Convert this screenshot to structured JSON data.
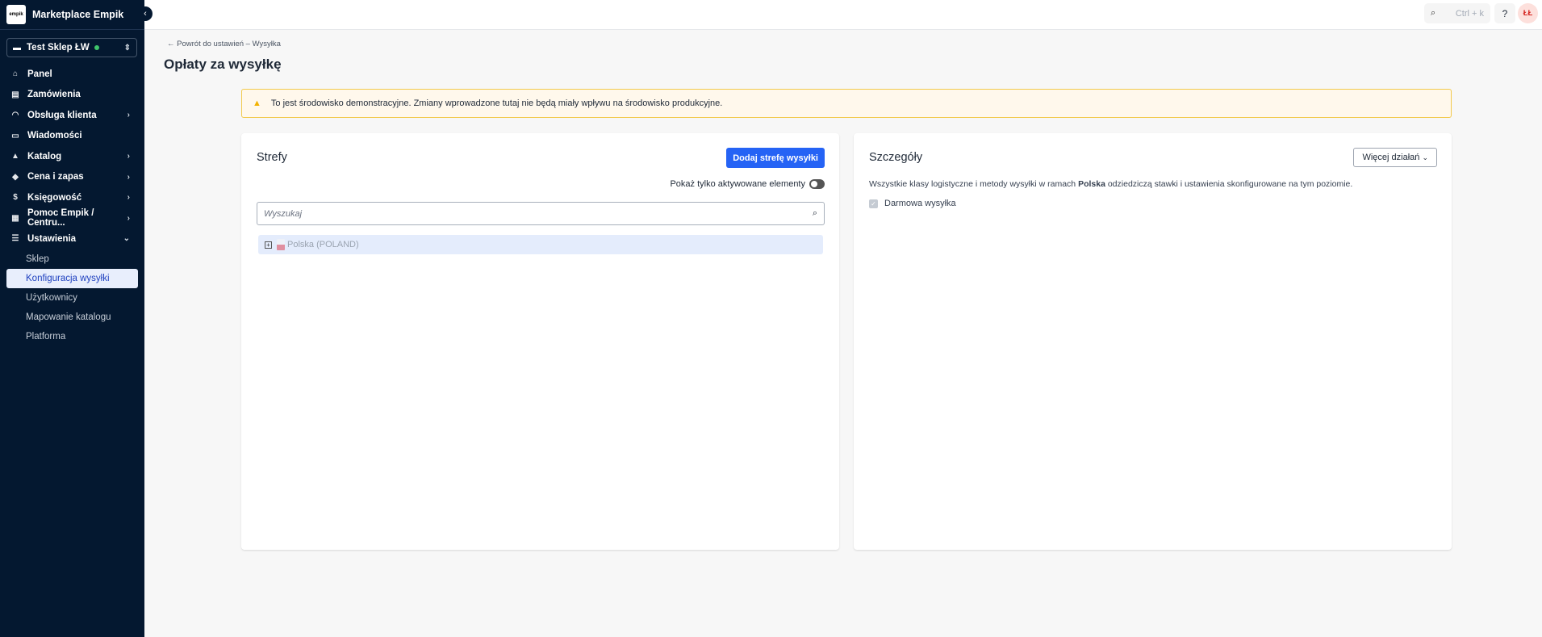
{
  "sidebar": {
    "brand": "Marketplace Empik",
    "logo_text": "empik",
    "store": "Test Sklep ŁW",
    "items": [
      {
        "label": "Panel",
        "icon": "home-icon",
        "glyph": "⌂",
        "chev": ""
      },
      {
        "label": "Zamówienia",
        "icon": "clipboard-icon",
        "glyph": "▤",
        "chev": ""
      },
      {
        "label": "Obsługa klienta",
        "icon": "headset-icon",
        "glyph": "◠",
        "chev": "›"
      },
      {
        "label": "Wiadomości",
        "icon": "message-icon",
        "glyph": "▭",
        "chev": ""
      },
      {
        "label": "Katalog",
        "icon": "shapes-icon",
        "glyph": "▲",
        "chev": "›"
      },
      {
        "label": "Cena i zapas",
        "icon": "tag-icon",
        "glyph": "◆",
        "chev": "›"
      },
      {
        "label": "Księgowość",
        "icon": "invoice-icon",
        "glyph": "$",
        "chev": "›"
      },
      {
        "label": "Pomoc Empik / Centru...",
        "icon": "grid-icon",
        "glyph": "▦",
        "chev": "›"
      },
      {
        "label": "Ustawienia",
        "icon": "sliders-icon",
        "glyph": "☰",
        "chev": "⌄"
      }
    ],
    "subitems": [
      "Sklep",
      "Konfiguracja wysyłki",
      "Użytkownicy",
      "Mapowanie katalogu",
      "Platforma"
    ]
  },
  "topbar": {
    "search_shortcut": "Ctrl + k",
    "avatar": "ŁŁ"
  },
  "breadcrumb": "Powrót do ustawień – Wysyłka",
  "title": "Opłaty za wysyłkę",
  "alert": "To jest środowisko demonstracyjne. Zmiany wprowadzone tutaj nie będą miały wpływu na środowisko produkcyjne.",
  "zones": {
    "title": "Strefy",
    "add_button": "Dodaj strefę wysyłki",
    "toggle_label": "Pokaż tylko aktywowane elementy",
    "toggle_on": false,
    "search_placeholder": "Wyszukaj",
    "tree": [
      {
        "label": "Polska (POLAND)",
        "expand": "+"
      }
    ]
  },
  "details": {
    "title": "Szczegóły",
    "more_button": "Więcej działań",
    "desc_before": "Wszystkie klasy logistyczne i metody wysyłki w ramach ",
    "desc_bold": "Polska",
    "desc_after": " odziedziczą stawki i ustawienia skonfigurowane na tym poziomie.",
    "checkbox_label": "Darmowa wysyłka",
    "checkbox_checked": true
  },
  "colors": {
    "sidebar": "#041830",
    "primary": "#2563f5",
    "alert_border": "#f2c94c"
  }
}
